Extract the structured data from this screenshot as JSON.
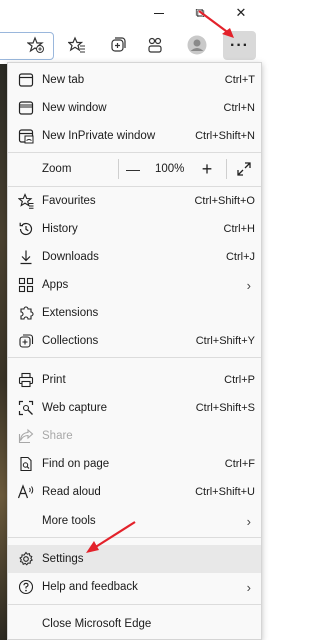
{
  "window": {
    "minimize_icon": "minimize-icon",
    "restore_icon": "restore-icon",
    "close_icon": "close-icon",
    "restore_glyph": "⧉",
    "close_glyph": "✕"
  },
  "toolbar": {
    "more_label": "···",
    "icons": [
      "favorite-add-icon",
      "favorites-icon",
      "collections-icon",
      "extensions-icon",
      "profile-icon",
      "more-icon"
    ]
  },
  "menu": {
    "new_tab": {
      "label": "New tab",
      "shortcut": "Ctrl+T"
    },
    "new_window": {
      "label": "New window",
      "shortcut": "Ctrl+N"
    },
    "new_inprivate": {
      "label": "New InPrivate window",
      "shortcut": "Ctrl+Shift+N"
    },
    "zoom": {
      "label": "Zoom",
      "minus": "—",
      "value": "100%",
      "plus": "+"
    },
    "favourites": {
      "label": "Favourites",
      "shortcut": "Ctrl+Shift+O"
    },
    "history": {
      "label": "History",
      "shortcut": "Ctrl+H"
    },
    "downloads": {
      "label": "Downloads",
      "shortcut": "Ctrl+J"
    },
    "apps": {
      "label": "Apps",
      "chevron": "›"
    },
    "extensions": {
      "label": "Extensions"
    },
    "collections": {
      "label": "Collections",
      "shortcut": "Ctrl+Shift+Y"
    },
    "print": {
      "label": "Print",
      "shortcut": "Ctrl+P"
    },
    "web_capture": {
      "label": "Web capture",
      "shortcut": "Ctrl+Shift+S"
    },
    "share": {
      "label": "Share"
    },
    "find_on_page": {
      "label": "Find on page",
      "shortcut": "Ctrl+F"
    },
    "read_aloud": {
      "label": "Read aloud",
      "shortcut": "Ctrl+Shift+U"
    },
    "more_tools": {
      "label": "More tools",
      "chevron": "›"
    },
    "settings": {
      "label": "Settings"
    },
    "help": {
      "label": "Help and feedback",
      "chevron": "›"
    },
    "close_edge": {
      "label": "Close Microsoft Edge"
    }
  },
  "colors": {
    "annotation_arrow": "#e3222b",
    "menu_bg": "#f9f9f9",
    "hover_bg": "#e8e8e8",
    "more_button_bg": "#d9d9d9"
  }
}
